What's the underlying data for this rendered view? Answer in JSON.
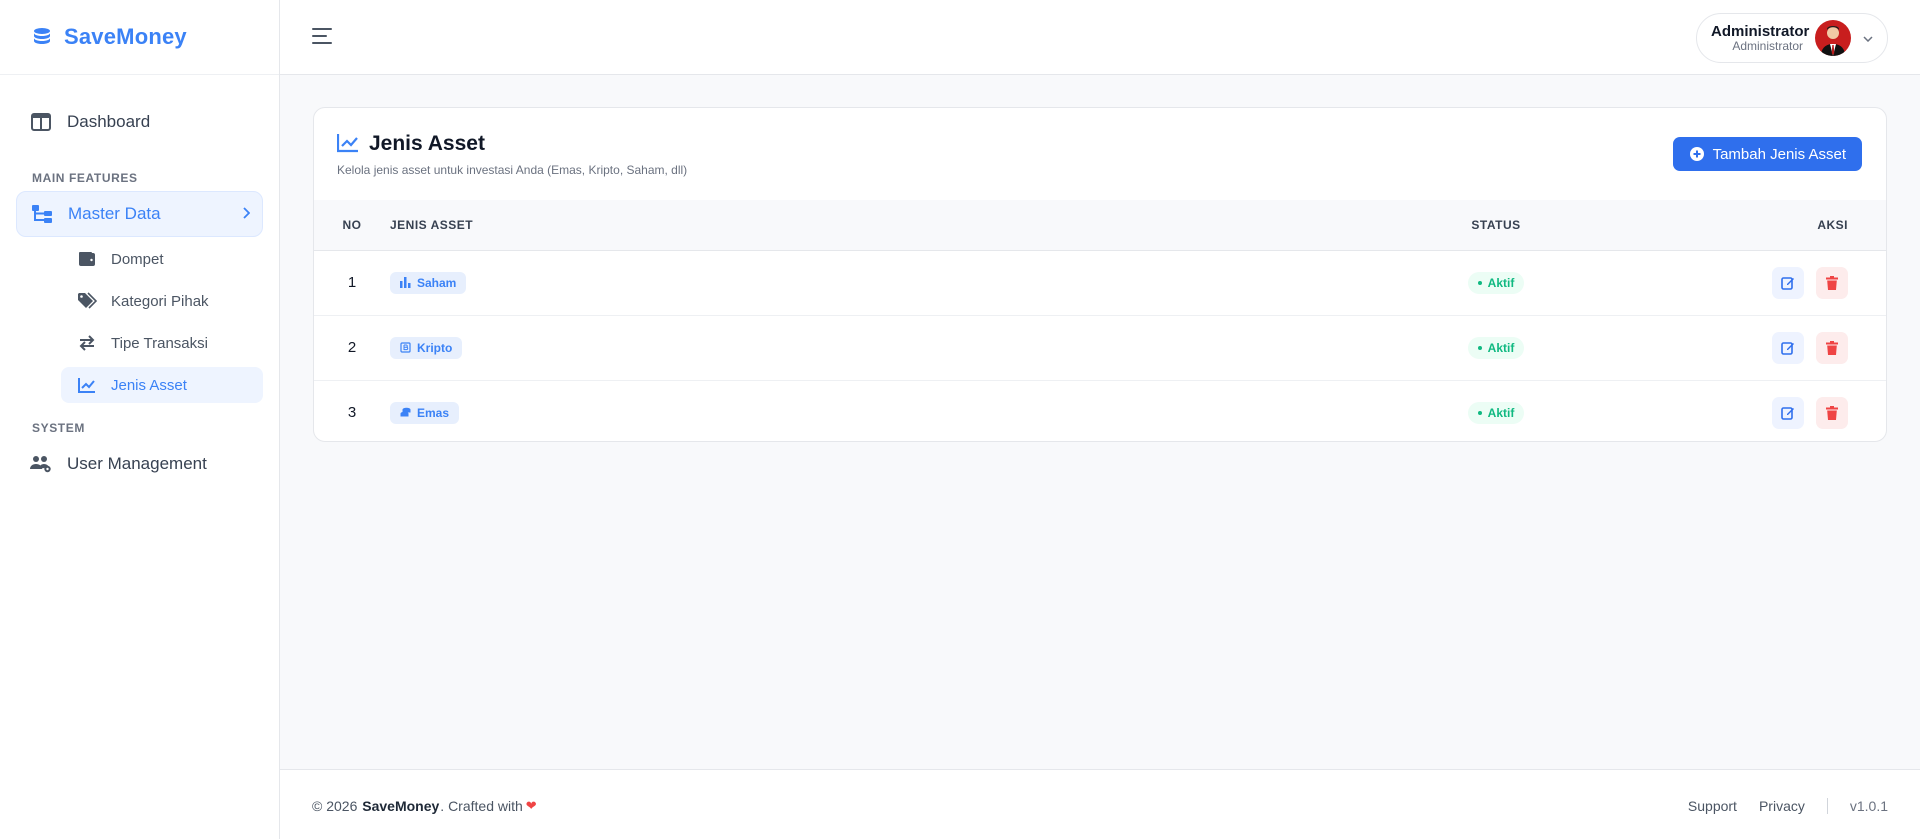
{
  "brand": {
    "name": "SaveMoney"
  },
  "sidebar": {
    "dashboard": "Dashboard",
    "section_main": "MAIN FEATURES",
    "master_data": "Master Data",
    "sub": [
      {
        "label": "Dompet",
        "icon": "wallet-icon"
      },
      {
        "label": "Kategori Pihak",
        "icon": "tags-icon"
      },
      {
        "label": "Tipe Transaksi",
        "icon": "exchange-icon"
      },
      {
        "label": "Jenis Asset",
        "icon": "chart-line-icon"
      }
    ],
    "section_system": "SYSTEM",
    "user_management": "User Management"
  },
  "header": {
    "user_name": "Administrator",
    "user_role": "Administrator"
  },
  "page": {
    "title": "Jenis Asset",
    "subtitle": "Kelola jenis asset untuk investasi Anda (Emas, Kripto, Saham, dll)",
    "add_button": "Tambah Jenis Asset"
  },
  "table": {
    "headers": {
      "no": "NO",
      "jenis": "JENIS ASSET",
      "status": "STATUS",
      "aksi": "AKSI"
    },
    "rows": [
      {
        "no": "1",
        "name": "Saham",
        "icon": "chart-bar-icon",
        "status": "Aktif"
      },
      {
        "no": "2",
        "name": "Kripto",
        "icon": "bitcoin-icon",
        "status": "Aktif"
      },
      {
        "no": "3",
        "name": "Emas",
        "icon": "coins-icon",
        "status": "Aktif"
      }
    ]
  },
  "footer": {
    "copyright": "© 2026",
    "brand": "SaveMoney",
    "crafted": ". Crafted with",
    "support": "Support",
    "privacy": "Privacy",
    "version": "v1.0.1"
  },
  "colors": {
    "accent": "#3b82f6",
    "success": "#10b981",
    "danger": "#ef4444"
  }
}
